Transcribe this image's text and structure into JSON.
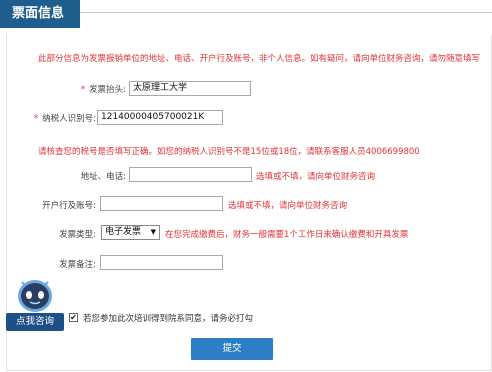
{
  "header": {
    "title": "票面信息"
  },
  "notice": "此部分信息为发票报销单位的地址、电话、开户行及账号，非个人信息。如有疑问，请向单位财务咨询，请勿随意填写",
  "form": {
    "invoice_header": {
      "label": "发票抬头:",
      "value": "太原理工大学"
    },
    "tax_id": {
      "label": "纳税人识别号:",
      "value": "12140000405700021K"
    },
    "tax_warning": "请核查您的税号是否填写正确。如您的纳税人识别号不是15位或18位，请联系客服人员4006699800",
    "address_phone": {
      "label": "地址、电话:",
      "value": "",
      "hint": "选填或不填，请向单位财务咨询"
    },
    "bank_account": {
      "label": "开户行及账号:",
      "value": "",
      "hint": "选填或不填，请向单位财务咨询"
    },
    "invoice_type": {
      "label": "发票类型:",
      "selected": "电子发票",
      "hint": "在您完成缴费后，财务一般需要1个工作日来确认缴费和开具发票"
    },
    "remark": {
      "label": "发票备注:",
      "value": ""
    }
  },
  "agreement": {
    "label": "若您参加此次培训得到院系同意，请务必打勾",
    "checked": true
  },
  "submit_label": "提交",
  "chat": {
    "label": "点我咨询"
  },
  "colors": {
    "header_bg": "#1e5e8f",
    "warning": "#e23333",
    "submit_bg": "#2c7fc4",
    "chat_bg": "#1e4f86"
  }
}
